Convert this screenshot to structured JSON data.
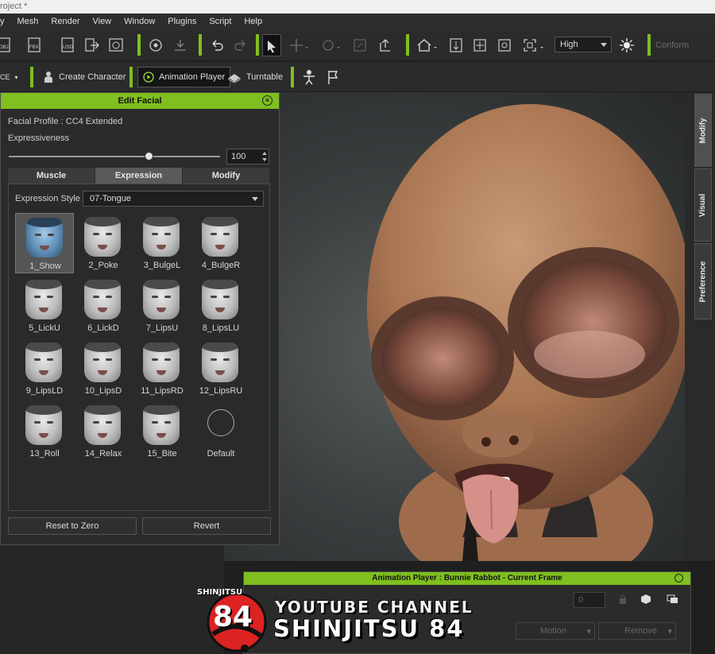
{
  "titlebar": {
    "title": "roject *"
  },
  "menu": [
    "y",
    "Mesh",
    "Render",
    "View",
    "Window",
    "Plugins",
    "Script",
    "Help"
  ],
  "toolbar1": {
    "quality": "High",
    "conform": "Conform",
    "icons": [
      "obj-export-icon",
      "fbx-export-icon",
      "usd-export-icon",
      "export-arrow-icon",
      "render-icon",
      "camera-orbit-icon",
      "home-icon",
      "height-icon",
      "fit-icon",
      "frame-icon",
      "zoom-fit-icon",
      "sun-icon"
    ]
  },
  "toolbar2": {
    "left_fragment": "CE",
    "create_character": "Create Character",
    "animation_player": "Animation Player",
    "turntable": "Turntable"
  },
  "edit_facial": {
    "title": "Edit Facial",
    "profile": "Facial Profile : CC4 Extended",
    "expressiveness_label": "Expressiveness",
    "expressiveness_value": "100",
    "expressiveness_fraction": 0.66,
    "tabs": [
      "Muscle",
      "Expression",
      "Modify"
    ],
    "active_tab": 1,
    "expression_style_label": "Expression Style :",
    "expression_style_value": "07-Tongue",
    "expressions": [
      "1_Show",
      "2_Poke",
      "3_BulgeL",
      "4_BulgeR",
      "5_LickU",
      "6_LickD",
      "7_LipsU",
      "8_LipsLU",
      "9_LipsLD",
      "10_LipsD",
      "11_LipsRD",
      "12_LipsRU",
      "13_Roll",
      "14_Relax",
      "15_Bite"
    ],
    "default_label": "Default",
    "reset_button": "Reset to Zero",
    "revert_button": "Revert"
  },
  "right_tabs": [
    "Modify",
    "Visual",
    "Preference"
  ],
  "anim_player": {
    "title": "Animation Player : Bunnie Rabbot - Current Frame",
    "frame_value": "0",
    "motion_label": "Motion",
    "remove_label": "Remove"
  },
  "watermark": {
    "badge": "SHINJITSU",
    "number": "84",
    "line1": "YOUTUBE CHANNEL",
    "line2": "SHINJITSU 84"
  },
  "colors": {
    "accent": "#7fbf1f",
    "panel": "#2b2b2b",
    "skin": "#b07a58"
  }
}
